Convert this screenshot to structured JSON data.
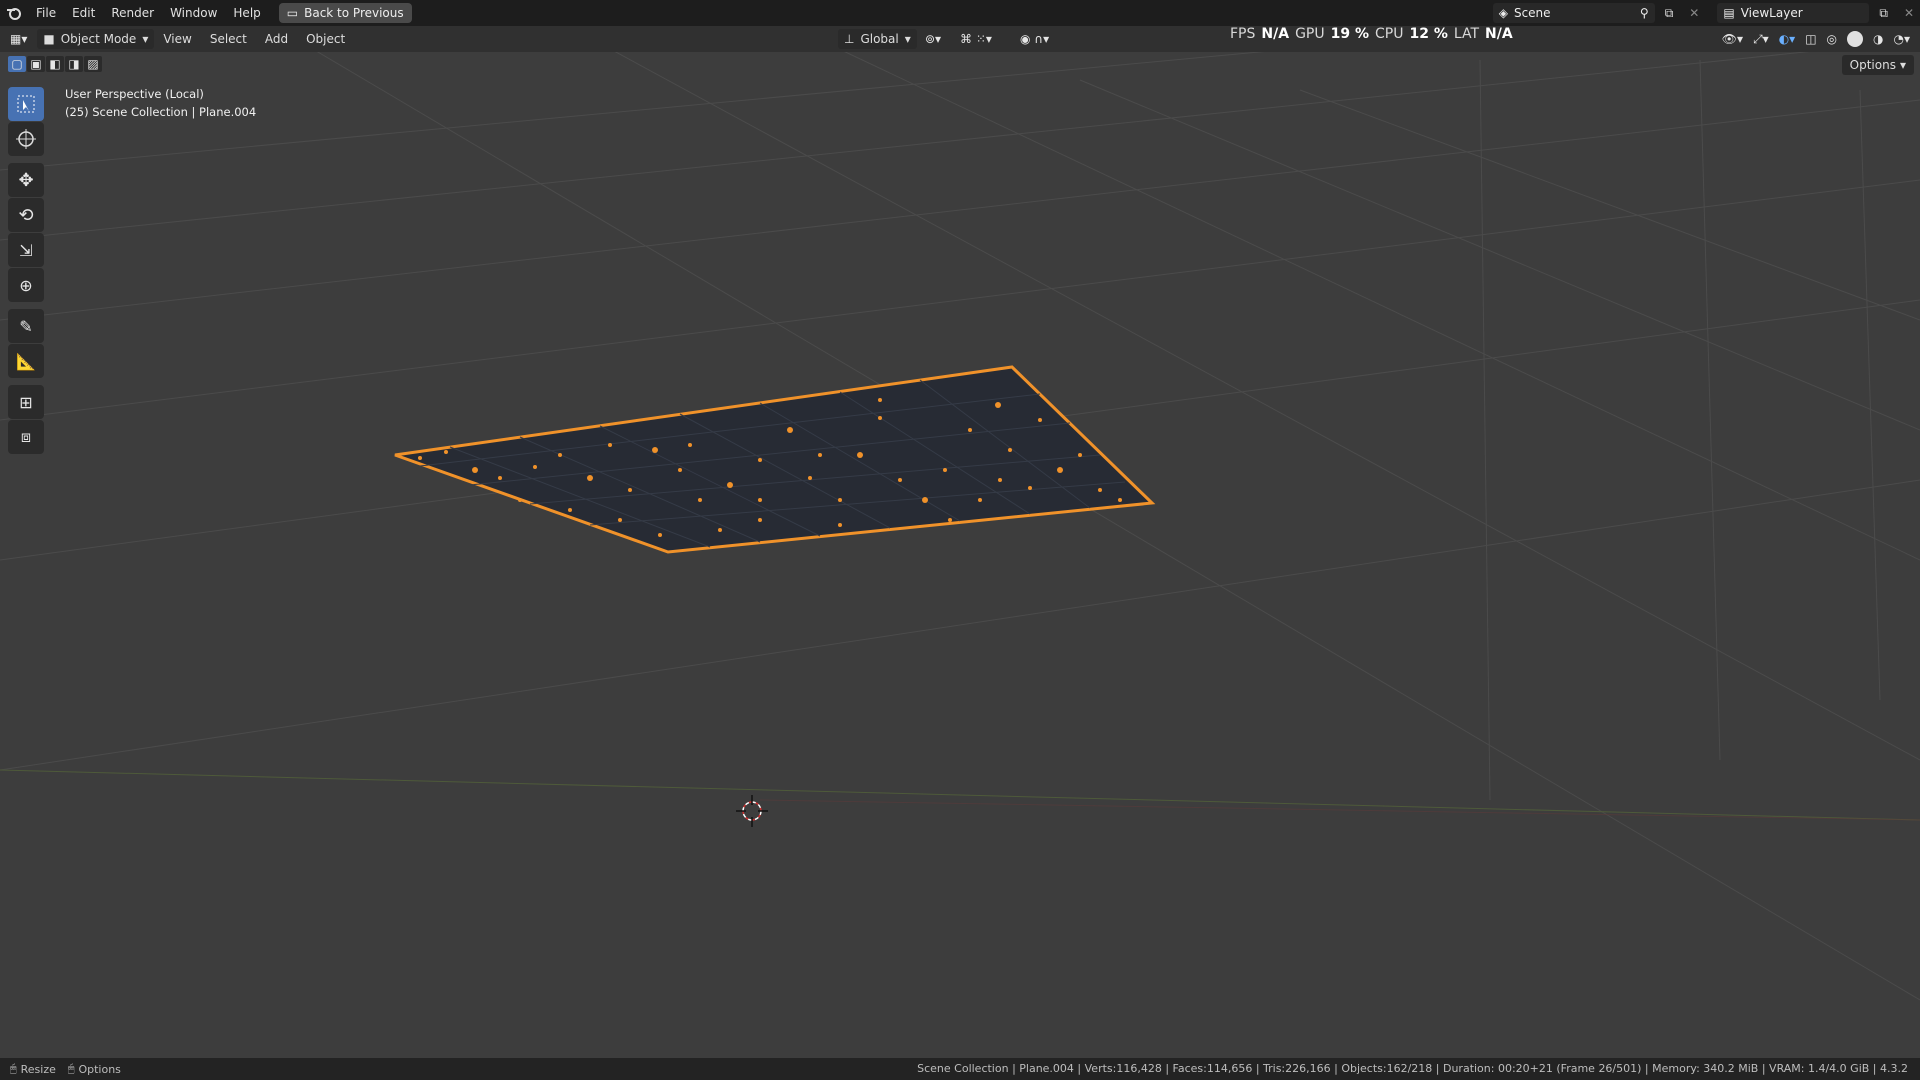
{
  "menubar": {
    "items": [
      "File",
      "Edit",
      "Render",
      "Window",
      "Help"
    ],
    "back_button": "Back to Previous",
    "scene": "Scene",
    "view_layer": "ViewLayer"
  },
  "header": {
    "mode": "Object Mode",
    "menus": [
      "View",
      "Select",
      "Add",
      "Object"
    ],
    "orientation": "Global",
    "options_label": "Options"
  },
  "perf": {
    "fps_label": "FPS",
    "fps_value": "N/A",
    "gpu_label": "GPU",
    "gpu_value": "19 %",
    "cpu_label": "CPU",
    "cpu_value": "12 %",
    "lat_label": "LAT",
    "lat_value": "N/A"
  },
  "viewport": {
    "perspective": "User Perspective (Local)",
    "collection": "(25) Scene Collection | Plane.004"
  },
  "statusbar": {
    "resize": "Resize",
    "options": "Options",
    "info": "Scene Collection | Plane.004 | Verts:116,428 | Faces:114,656 | Tris:226,166 | Objects:162/218 | Duration: 00:20+21 (Frame 26/501) | Memory: 340.2 MiB | VRAM: 1.4/4.0 GiB | 4.3.2"
  },
  "colors": {
    "selection": "#f0922a",
    "accent": "#4772b3",
    "viewport_bg": "#3d3d3d"
  }
}
